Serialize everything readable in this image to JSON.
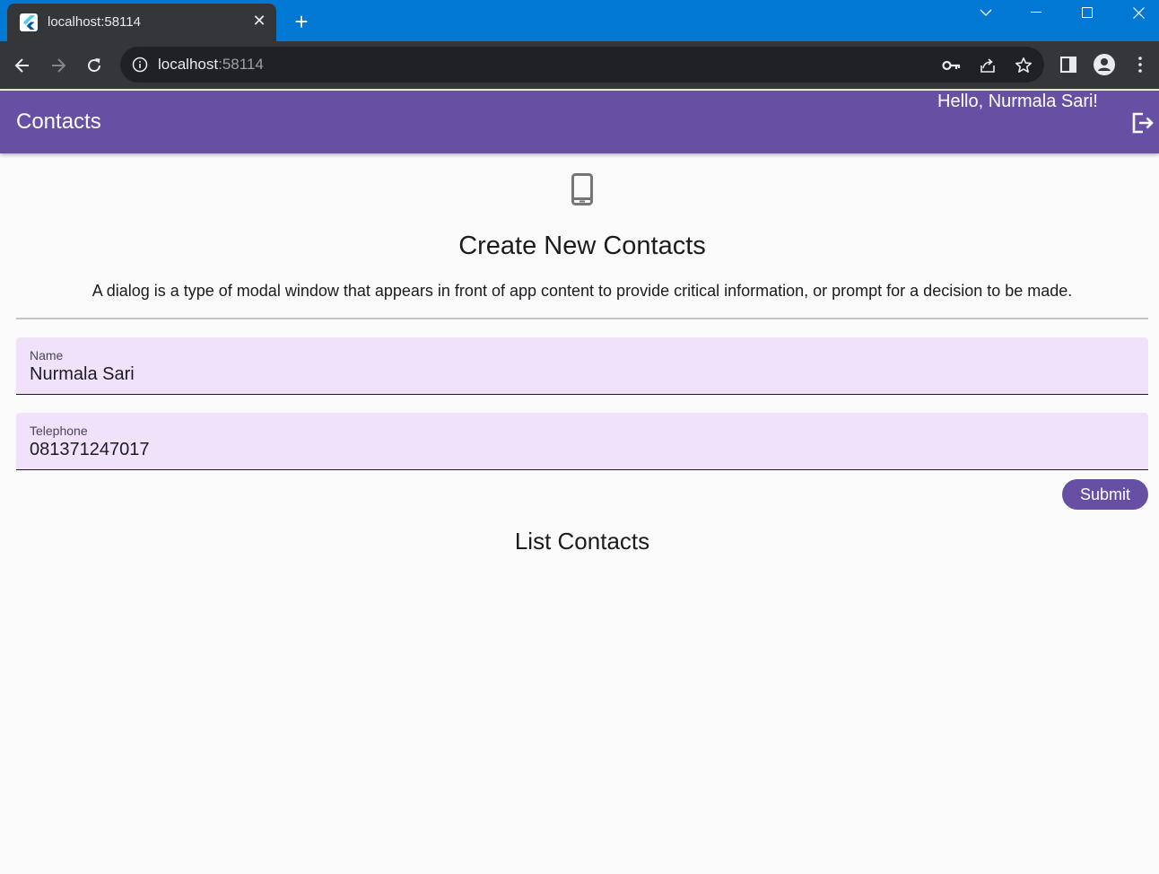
{
  "browser": {
    "tab_title": "localhost:58114",
    "tab_close": "✕",
    "new_tab": "+",
    "url_host": "localhost",
    "url_port": ":58114"
  },
  "appbar": {
    "title": "Contacts",
    "greeting": "Hello, Nurmala Sari!"
  },
  "form": {
    "headline": "Create New Contacts",
    "description": "A dialog is a type of modal window that appears in front of app content to provide critical information, or prompt for a decision to be made.",
    "name_label": "Name",
    "name_value": "Nurmala Sari",
    "telephone_label": "Telephone",
    "telephone_value": "081371247017",
    "submit_label": "Submit"
  },
  "list": {
    "title": "List Contacts"
  },
  "colors": {
    "primary": "#6750a4",
    "field_fill": "#f0e2fb",
    "titlebar": "#0078d4",
    "chrome_dark": "#35363a"
  },
  "icons": [
    "flutter-favicon",
    "info-icon",
    "key-icon",
    "share-icon",
    "star-icon",
    "sidepanel-icon",
    "profile-icon",
    "menu-icon",
    "logout-icon",
    "phone-icon"
  ]
}
